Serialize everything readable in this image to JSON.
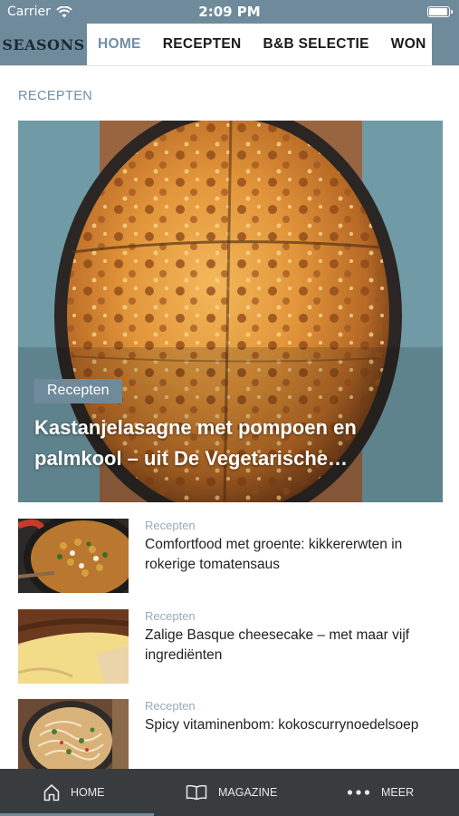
{
  "status_bar": {
    "carrier": "Carrier",
    "time": "2:09 PM",
    "battery_level": 0.95
  },
  "nav": {
    "logo": "SEASONS",
    "tabs": [
      {
        "label": "HOME",
        "active": true
      },
      {
        "label": "RECEPTEN",
        "active": false
      },
      {
        "label": "B&B SELECTIE",
        "active": false
      },
      {
        "label": "WONEN",
        "active": false
      }
    ]
  },
  "section_label": "RECEPTEN",
  "hero": {
    "category": "Recepten",
    "title": "Kastanjelasagne met pompoen en palmkool – uit De Vegetarische…",
    "image": "lasagne-dish-photo"
  },
  "articles": [
    {
      "category": "Recepten",
      "title": "Comfortfood met groente: kikkererwten in rokerige tomatensaus",
      "image": "chickpea-pan-photo"
    },
    {
      "category": "Recepten",
      "title": "Zalige Basque cheesecake – met maar vijf ingrediënten",
      "image": "cheesecake-photo"
    },
    {
      "category": "Recepten",
      "title": "Spicy vitaminenbom: kokoscurrynoedelsoep",
      "image": "noodle-soup-photo"
    }
  ],
  "tabbar": {
    "items": [
      {
        "label": "HOME",
        "icon": "home-icon",
        "active": true
      },
      {
        "label": "MAGAZINE",
        "icon": "book-icon",
        "active": false
      },
      {
        "label": "MEER",
        "icon": "more-icon",
        "active": false
      }
    ]
  },
  "colors": {
    "brand": "#6f8a9b",
    "accent": "#6f8fa6",
    "tabbar_bg": "#393c3f"
  }
}
